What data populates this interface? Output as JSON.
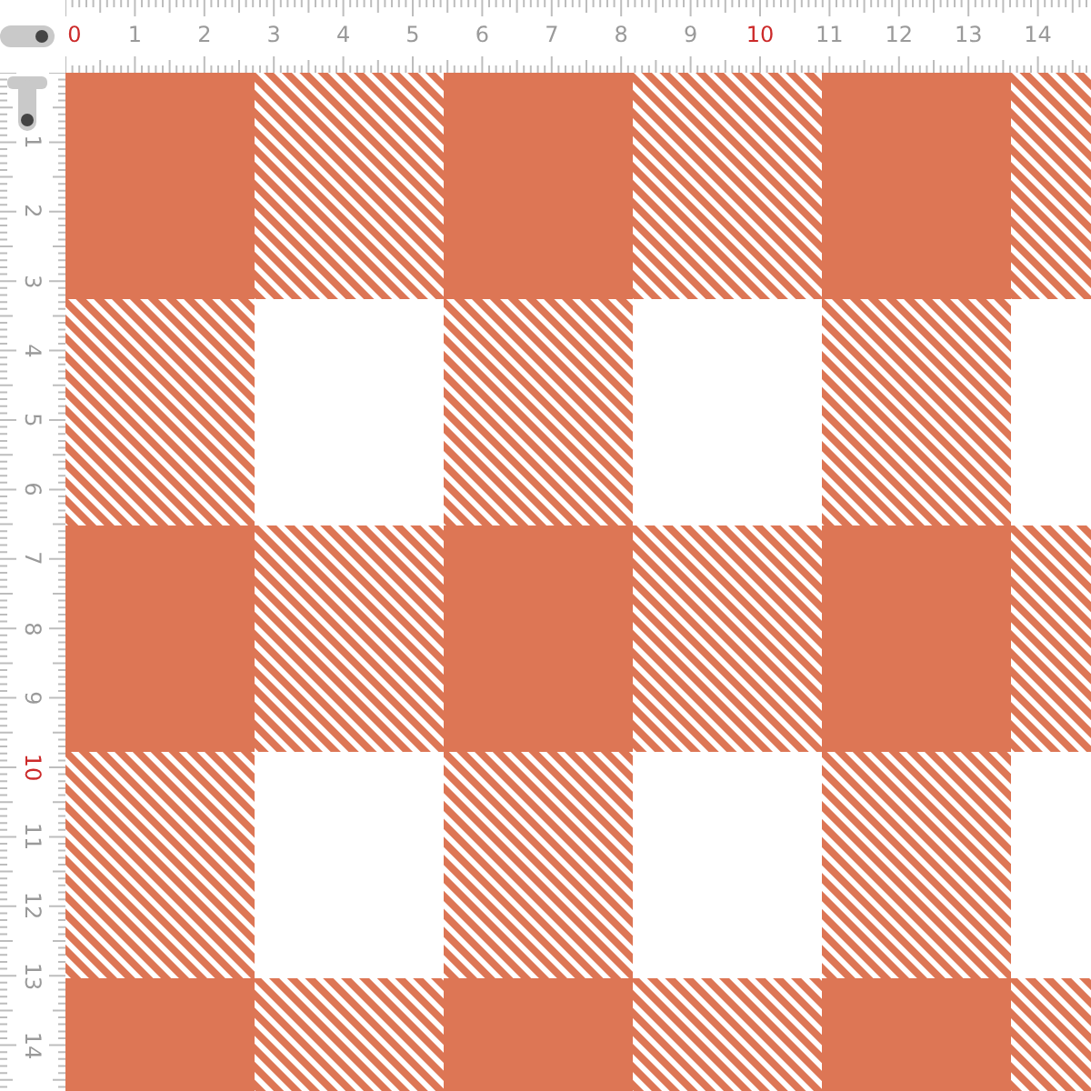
{
  "top_ruler": {
    "labels": [
      {
        "text": "0",
        "highlighted": true
      },
      {
        "text": "1",
        "highlighted": false
      },
      {
        "text": "2",
        "highlighted": false
      },
      {
        "text": "3",
        "highlighted": false
      },
      {
        "text": "4",
        "highlighted": false
      },
      {
        "text": "5",
        "highlighted": false
      },
      {
        "text": "6",
        "highlighted": false
      },
      {
        "text": "7",
        "highlighted": false
      },
      {
        "text": "8",
        "highlighted": false
      },
      {
        "text": "9",
        "highlighted": false
      },
      {
        "text": "10",
        "highlighted": true
      },
      {
        "text": "11",
        "highlighted": false
      },
      {
        "text": "12",
        "highlighted": false
      },
      {
        "text": "13",
        "highlighted": false
      },
      {
        "text": "14",
        "highlighted": false
      }
    ]
  },
  "left_ruler": {
    "labels": [
      {
        "text": "1",
        "highlighted": false
      },
      {
        "text": "2",
        "highlighted": false
      },
      {
        "text": "3",
        "highlighted": false
      },
      {
        "text": "4",
        "highlighted": false
      },
      {
        "text": "5",
        "highlighted": false
      },
      {
        "text": "6",
        "highlighted": false
      },
      {
        "text": "7",
        "highlighted": false
      },
      {
        "text": "8",
        "highlighted": false
      },
      {
        "text": "9",
        "highlighted": false
      },
      {
        "text": "10",
        "highlighted": true
      },
      {
        "text": "11",
        "highlighted": false
      },
      {
        "text": "12",
        "highlighted": false
      },
      {
        "text": "13",
        "highlighted": false
      },
      {
        "text": "14",
        "highlighted": false
      }
    ]
  }
}
